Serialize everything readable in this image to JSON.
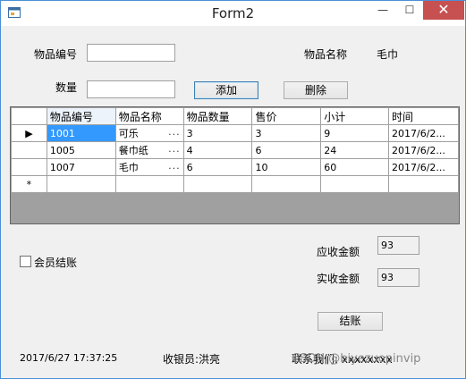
{
  "window": {
    "title": "Form2",
    "minimize_glyph": "—",
    "maximize_glyph": "☐",
    "close_glyph": "✕"
  },
  "form": {
    "item_code_label": "物品编号",
    "item_code_value": "",
    "item_name_label": "物品名称",
    "item_name_value": "毛巾",
    "quantity_label": "数量",
    "quantity_value": "",
    "add_button": "添加",
    "delete_button": "删除"
  },
  "grid": {
    "columns": [
      "物品编号",
      "物品名称",
      "物品数量",
      "售价",
      "小计",
      "时间"
    ],
    "rows": [
      [
        "1001",
        "可乐",
        "3",
        "3",
        "9",
        "2017/6/2..."
      ],
      [
        "1005",
        "餐巾纸",
        "4",
        "6",
        "24",
        "2017/6/2..."
      ],
      [
        "1007",
        "毛巾",
        "6",
        "10",
        "60",
        "2017/6/2..."
      ]
    ],
    "current_row_marker": "▶",
    "new_row_marker": "*",
    "ellipsis": "..."
  },
  "footer": {
    "member_checkout_label": "会员结账",
    "receivable_label": "应收金额",
    "receivable_value": "93",
    "received_label": "实收金额",
    "received_value": "93",
    "checkout_button": "结账",
    "datetime": "2017/6/27 17:37:25",
    "cashier": "收银员:洪亮",
    "contact": "联系我们: xxxxxxxx",
    "watermark": "CSDN @biyezuopinvip"
  }
}
